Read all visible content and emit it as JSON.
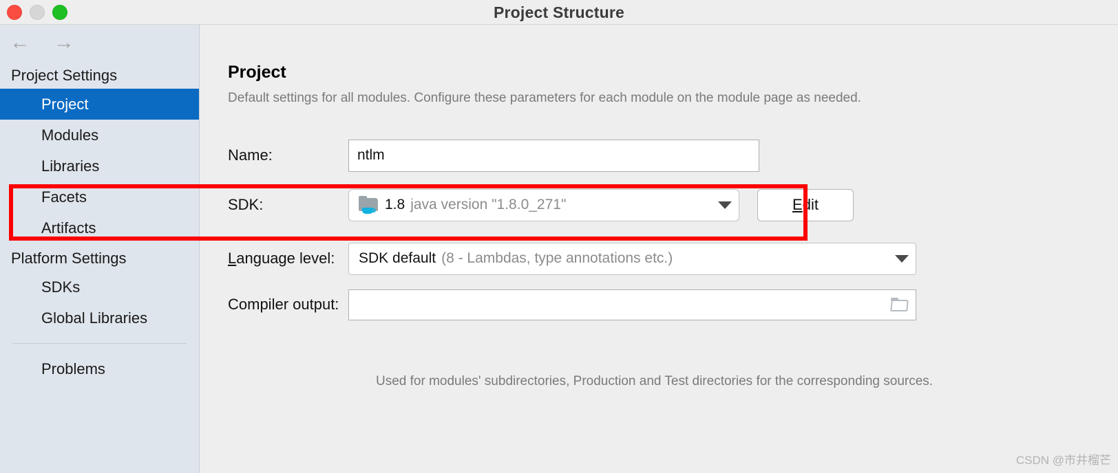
{
  "window": {
    "title": "Project Structure",
    "traffic_lights": [
      "close-button",
      "minimize-button",
      "zoom-button"
    ]
  },
  "navigation": {
    "back_icon": "←",
    "forward_icon": "→"
  },
  "sidebar": {
    "groups": [
      {
        "title": "Project Settings",
        "items": [
          {
            "label": "Project",
            "selected": true
          },
          {
            "label": "Modules",
            "selected": false
          },
          {
            "label": "Libraries",
            "selected": false
          },
          {
            "label": "Facets",
            "selected": false
          },
          {
            "label": "Artifacts",
            "selected": false
          }
        ]
      },
      {
        "title": "Platform Settings",
        "items": [
          {
            "label": "SDKs",
            "selected": false
          },
          {
            "label": "Global Libraries",
            "selected": false
          }
        ]
      }
    ],
    "footer_item": "Problems"
  },
  "main": {
    "title": "Project",
    "subtitle": "Default settings for all modules. Configure these parameters for each module on the module page as needed.",
    "fields": {
      "name": {
        "label": "Name:",
        "value": "ntlm",
        "placeholder": ""
      },
      "sdk": {
        "label": "SDK:",
        "icon": "java-sdk-icon",
        "value_strong": "1.8",
        "value_muted": "java version \"1.8.0_271\"",
        "edit_button": "Edit",
        "edit_mnemonic": "E"
      },
      "language_level": {
        "label": "Language level:",
        "label_mnemonic": "L",
        "value_strong": "SDK default",
        "value_muted": "(8 - Lambdas, type annotations etc.)"
      },
      "compiler_output": {
        "label": "Compiler output:",
        "value": "",
        "placeholder": "",
        "browse_icon": "folder-browse-icon",
        "hint": "Used for modules' subdirectories, Production and Test directories for the corresponding sources."
      }
    }
  },
  "annotation": {
    "color": "#fc0000",
    "target": "sdk-row"
  },
  "watermark": "CSDN @市井榴芒",
  "colors": {
    "accent_selected": "#0b6bc3",
    "sidebar_bg": "#dfe5ec",
    "window_bg": "#eeeeee",
    "annotation_red": "#fc0000",
    "java_cup": "#12b2e0"
  }
}
